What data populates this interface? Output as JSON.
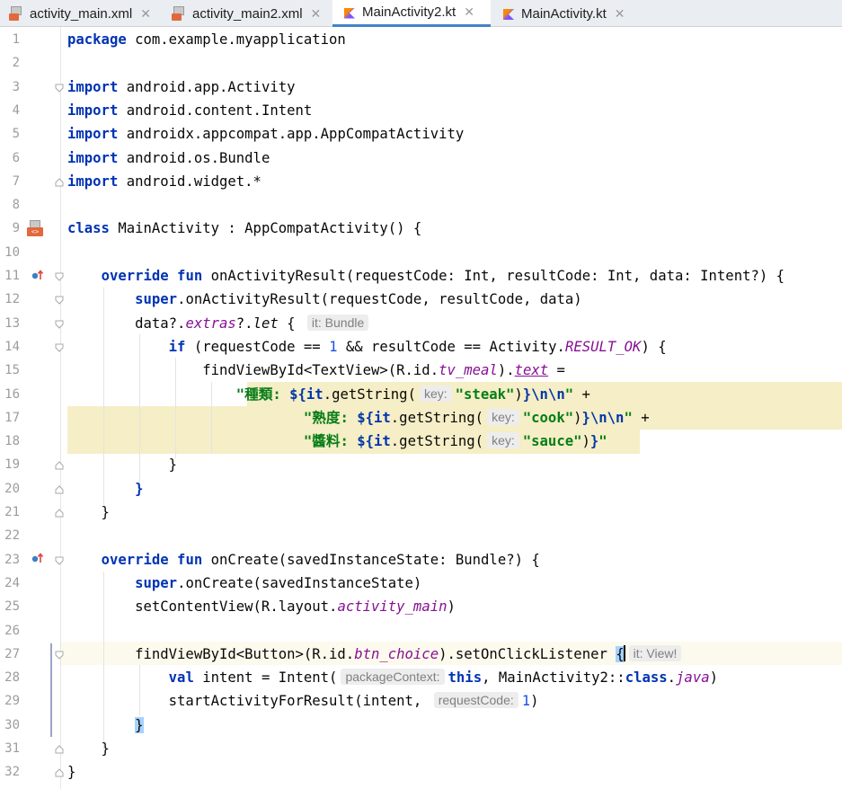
{
  "tabs": [
    {
      "label": "activity_main.xml",
      "type": "xml",
      "active": false
    },
    {
      "label": "activity_main2.xml",
      "type": "xml",
      "active": false
    },
    {
      "label": "MainActivity2.kt",
      "type": "kt",
      "active": true
    },
    {
      "label": "MainActivity.kt",
      "type": "kt",
      "active": false
    }
  ],
  "close_glyph": "✕",
  "lines": [
    {
      "n": "1",
      "t": [
        [
          "kw",
          "package"
        ],
        [
          "",
          " com.example.myapplication"
        ]
      ]
    },
    {
      "n": "2",
      "t": []
    },
    {
      "n": "3",
      "t": [
        [
          "kw",
          "import"
        ],
        [
          "",
          " android.app.Activity"
        ]
      ]
    },
    {
      "n": "4",
      "t": [
        [
          "kw",
          "import"
        ],
        [
          "",
          " android.content.Intent"
        ]
      ]
    },
    {
      "n": "5",
      "t": [
        [
          "kw",
          "import"
        ],
        [
          "",
          " androidx.appcompat.app.AppCompatActivity"
        ]
      ]
    },
    {
      "n": "6",
      "t": [
        [
          "kw",
          "import"
        ],
        [
          "",
          " android.os.Bundle"
        ]
      ]
    },
    {
      "n": "7",
      "t": [
        [
          "kw",
          "import"
        ],
        [
          "",
          " android.widget.*"
        ]
      ]
    },
    {
      "n": "8",
      "t": []
    },
    {
      "n": "9",
      "t": [
        [
          "kw",
          "class"
        ],
        [
          "",
          " MainActivity : AppCompatActivity() {"
        ]
      ]
    },
    {
      "n": "10",
      "t": []
    },
    {
      "n": "11",
      "t": [
        [
          "",
          "    "
        ],
        [
          "kw",
          "override fun"
        ],
        [
          "",
          " onActivityResult(requestCode: Int, resultCode: Int, data: Intent?) {"
        ]
      ]
    },
    {
      "n": "12",
      "t": [
        [
          "",
          "        "
        ],
        [
          "kw",
          "super"
        ],
        [
          "",
          ".onActivityResult(requestCode, resultCode, data)"
        ]
      ]
    },
    {
      "n": "13",
      "t": [
        [
          "",
          "        data?."
        ],
        [
          "it",
          "extras"
        ],
        [
          "",
          "?."
        ],
        [
          "ita",
          "let"
        ],
        [
          "",
          " { "
        ],
        [
          "hint",
          "it: Bundle"
        ]
      ]
    },
    {
      "n": "14",
      "t": [
        [
          "",
          "            "
        ],
        [
          "kw",
          "if"
        ],
        [
          "",
          " (requestCode == "
        ],
        [
          "num",
          "1"
        ],
        [
          "",
          " && resultCode == Activity."
        ],
        [
          "it",
          "RESULT_OK"
        ],
        [
          "",
          ") {"
        ]
      ]
    },
    {
      "n": "15",
      "t": [
        [
          "",
          "                findViewById<TextView>(R.id."
        ],
        [
          "it",
          "tv_meal"
        ],
        [
          "",
          ")."
        ],
        [
          "itu",
          "text"
        ],
        [
          "",
          " ="
        ]
      ]
    },
    {
      "n": "16",
      "t": [
        [
          "",
          "                    "
        ],
        [
          "str",
          "\"種類: "
        ],
        [
          "esc",
          "${"
        ],
        [
          "kw",
          "it"
        ],
        [
          "",
          ".getString("
        ],
        [
          "hint",
          "key:"
        ],
        [
          "str",
          "\"steak\""
        ],
        [
          "",
          ")"
        ],
        [
          "esc",
          "}\\n\\n"
        ],
        [
          "str",
          "\""
        ],
        [
          "",
          " +"
        ]
      ]
    },
    {
      "n": "17",
      "t": [
        [
          "",
          "                            "
        ],
        [
          "str",
          "\"熟度: "
        ],
        [
          "esc",
          "${"
        ],
        [
          "kw",
          "it"
        ],
        [
          "",
          ".getString("
        ],
        [
          "hint",
          "key:"
        ],
        [
          "str",
          "\"cook\""
        ],
        [
          "",
          ")"
        ],
        [
          "esc",
          "}\\n\\n"
        ],
        [
          "str",
          "\""
        ],
        [
          "",
          " +"
        ]
      ]
    },
    {
      "n": "18",
      "t": [
        [
          "",
          "                            "
        ],
        [
          "str",
          "\"醬料: "
        ],
        [
          "esc",
          "${"
        ],
        [
          "kw",
          "it"
        ],
        [
          "",
          ".getString("
        ],
        [
          "hint",
          "key:"
        ],
        [
          "str",
          "\"sauce\""
        ],
        [
          "",
          ")"
        ],
        [
          "esc",
          "}"
        ],
        [
          "str",
          "\""
        ]
      ]
    },
    {
      "n": "19",
      "t": [
        [
          "",
          "            }"
        ]
      ]
    },
    {
      "n": "20",
      "t": [
        [
          "",
          "        "
        ],
        [
          "kw",
          "}"
        ]
      ]
    },
    {
      "n": "21",
      "t": [
        [
          "",
          "    }"
        ]
      ]
    },
    {
      "n": "22",
      "t": []
    },
    {
      "n": "23",
      "t": [
        [
          "",
          "    "
        ],
        [
          "kw",
          "override fun"
        ],
        [
          "",
          " onCreate(savedInstanceState: Bundle?) {"
        ]
      ]
    },
    {
      "n": "24",
      "t": [
        [
          "",
          "        "
        ],
        [
          "kw",
          "super"
        ],
        [
          "",
          ".onCreate(savedInstanceState)"
        ]
      ]
    },
    {
      "n": "25",
      "t": [
        [
          "",
          "        setContentView(R.layout."
        ],
        [
          "it",
          "activity_main"
        ],
        [
          "",
          ")"
        ]
      ]
    },
    {
      "n": "26",
      "t": []
    },
    {
      "n": "27",
      "t": [
        [
          "",
          "        findViewById<Button>(R.id."
        ],
        [
          "it",
          "btn_choice"
        ],
        [
          "",
          ").setOnClickListener "
        ],
        [
          "brace",
          "{"
        ],
        [
          "caret",
          ""
        ],
        [
          "",
          ""
        ],
        [
          "hint",
          "it: View!"
        ]
      ]
    },
    {
      "n": "28",
      "t": [
        [
          "",
          "            "
        ],
        [
          "kw",
          "val"
        ],
        [
          "",
          " intent = Intent("
        ],
        [
          "hint",
          "packageContext:"
        ],
        [
          "kw",
          "this"
        ],
        [
          "",
          ", MainActivity2::"
        ],
        [
          "kw",
          "class"
        ],
        [
          "",
          "."
        ],
        [
          "it",
          "java"
        ],
        [
          "",
          ")"
        ]
      ]
    },
    {
      "n": "29",
      "t": [
        [
          "",
          "            startActivityForResult(intent, "
        ],
        [
          "hint",
          "requestCode:"
        ],
        [
          "num",
          "1"
        ],
        [
          "",
          ")"
        ]
      ]
    },
    {
      "n": "30",
      "t": [
        [
          "",
          "        "
        ],
        [
          "brace",
          "}"
        ]
      ]
    },
    {
      "n": "31",
      "t": [
        [
          "",
          "    }"
        ]
      ]
    },
    {
      "n": "32",
      "t": [
        [
          "",
          "}"
        ]
      ]
    }
  ],
  "colors": {
    "keyword": "#0033b3",
    "string": "#067d17",
    "highlight": "#f5eec6",
    "accent": "#4083c9"
  }
}
